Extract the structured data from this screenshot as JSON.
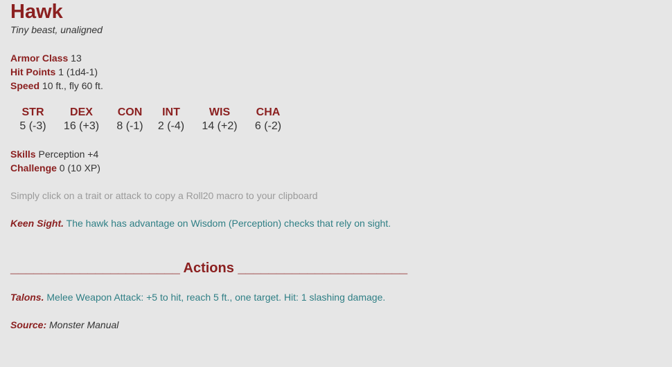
{
  "monster": {
    "name": "Hawk",
    "type_line": "Tiny beast, unaligned"
  },
  "stats": {
    "armor_class_label": "Armor Class",
    "armor_class_value": "13",
    "hit_points_label": "Hit Points",
    "hit_points_value": "1 (1d4-1)",
    "speed_label": "Speed",
    "speed_value": "10 ft., fly 60 ft."
  },
  "abilities": [
    {
      "name": "STR",
      "value": "5 (-3)"
    },
    {
      "name": "DEX",
      "value": "16 (+3)"
    },
    {
      "name": "CON",
      "value": "8 (-1)"
    },
    {
      "name": "INT",
      "value": "2 (-4)"
    },
    {
      "name": "WIS",
      "value": "14 (+2)"
    },
    {
      "name": "CHA",
      "value": "6 (-2)"
    }
  ],
  "extra": {
    "skills_label": "Skills",
    "skills_value": "Perception +4",
    "challenge_label": "Challenge",
    "challenge_value": "0 (10 XP)"
  },
  "hint": "Simply click on a trait or attack to copy a Roll20 macro to your clipboard",
  "traits": [
    {
      "name": "Keen Sight.",
      "text": "The hawk has advantage on Wisdom (Perception) checks that rely on sight."
    }
  ],
  "actions_heading": "______________________ Actions ______________________",
  "actions": [
    {
      "name": "Talons.",
      "text": "Melee Weapon Attack: +5 to hit, reach 5 ft., one target. Hit: 1 slashing damage."
    }
  ],
  "source": {
    "label": "Source:",
    "value": "Monster Manual"
  },
  "colors": {
    "background": "#e6e6e6",
    "accent": "#8b2020",
    "link": "#2f7f85",
    "hint": "#9a9a9a",
    "text": "#333333"
  }
}
